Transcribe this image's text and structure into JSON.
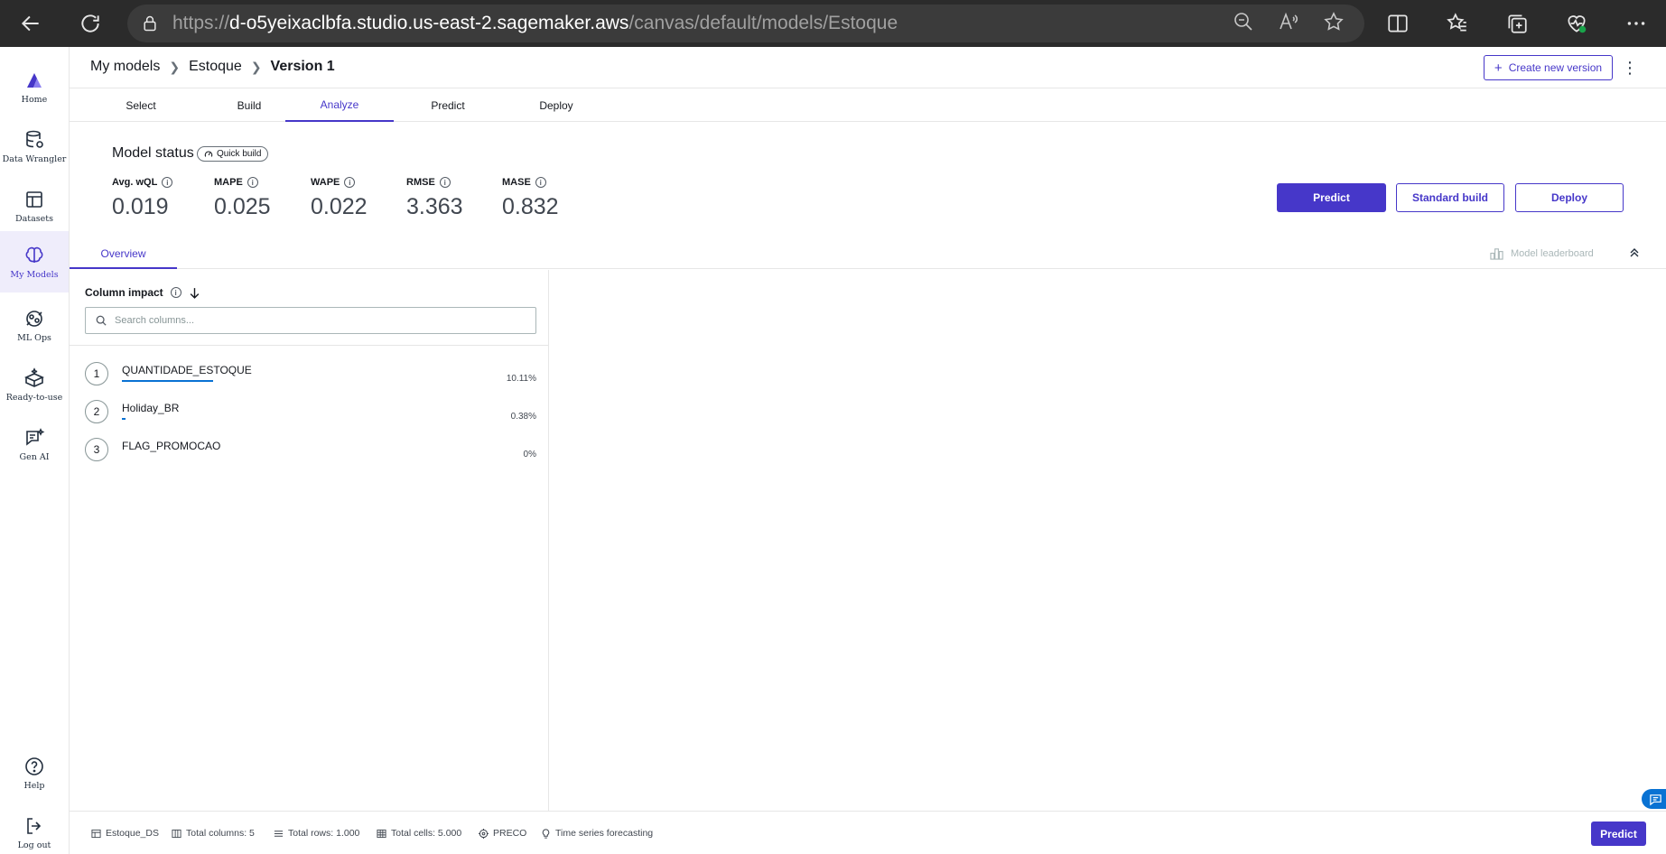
{
  "browser": {
    "url_prefix": "https://",
    "url_host": "d-o5yeixaclbfa.studio.us-east-2.sagemaker.aws",
    "url_path": "/canvas/default/models/Estoque",
    "icons": [
      "back-icon",
      "refresh-icon",
      "lock-icon",
      "zoom-out-icon",
      "read-aloud-icon",
      "favorite-star-icon",
      "split-screen-icon",
      "favorites-icon",
      "collections-icon",
      "browser-essentials-icon",
      "more-icon"
    ]
  },
  "sidebar": {
    "items": [
      {
        "label": "Home",
        "icon": "canvas-logo-icon"
      },
      {
        "label": "Data Wrangler",
        "icon": "database-icon"
      },
      {
        "label": "Datasets",
        "icon": "table-icon"
      },
      {
        "label": "My Models",
        "icon": "brain-icon",
        "active": true
      },
      {
        "label": "ML Ops",
        "icon": "mlops-icon"
      },
      {
        "label": "Ready-to-use",
        "icon": "box-icon"
      },
      {
        "label": "Gen AI",
        "icon": "chat-sparkle-icon"
      },
      {
        "label": "Help",
        "icon": "help-icon"
      },
      {
        "label": "Log out",
        "icon": "logout-icon"
      }
    ]
  },
  "breadcrumb": {
    "items": [
      "My models",
      "Estoque",
      "Version 1"
    ]
  },
  "header": {
    "create_version": "Create new version"
  },
  "steps": [
    "Select",
    "Build",
    "Analyze",
    "Predict",
    "Deploy"
  ],
  "active_step": "Analyze",
  "model_status": {
    "title": "Model status",
    "badge": "Quick build",
    "metrics": [
      {
        "label": "Avg. wQL",
        "value": "0.019"
      },
      {
        "label": "MAPE",
        "value": "0.025"
      },
      {
        "label": "WAPE",
        "value": "0.022"
      },
      {
        "label": "RMSE",
        "value": "3.363"
      },
      {
        "label": "MASE",
        "value": "0.832"
      }
    ],
    "buttons": {
      "predict": "Predict",
      "standard_build": "Standard build",
      "deploy": "Deploy"
    }
  },
  "overview": {
    "tab": "Overview",
    "leaderboard": "Model leaderboard"
  },
  "column_impact": {
    "title": "Column impact",
    "search_placeholder": "Search columns...",
    "rows": [
      {
        "rank": "1",
        "name": "QUANTIDADE_ESTOQUE",
        "percent": "10.11%",
        "fraction": 0.1011
      },
      {
        "rank": "2",
        "name": "Holiday_BR",
        "percent": "0.38%",
        "fraction": 0.0038
      },
      {
        "rank": "3",
        "name": "FLAG_PROMOCAO",
        "percent": "0%",
        "fraction": 0
      }
    ]
  },
  "footer": {
    "dataset": "Estoque_DS",
    "total_columns": "Total columns: 5",
    "total_rows": "Total rows: 1.000",
    "total_cells": "Total cells: 5.000",
    "target": "PRECO",
    "model_type": "Time series forecasting",
    "predict": "Predict"
  },
  "colors": {
    "accent": "#4637c9",
    "impact_bar": "#0972d3",
    "browser_bar": "#2b2b2b"
  }
}
